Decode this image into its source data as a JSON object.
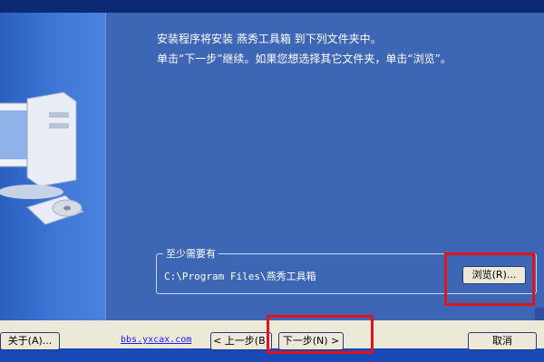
{
  "instructions": {
    "line1": "安装程序将安装 燕秀工具箱 到下列文件夹中。",
    "line2": "单击“下一步”继续。如果您想选择其它文件夹，单击“浏览”。"
  },
  "destination": {
    "group_label": "至少需要有",
    "path": "C:\\Program Files\\燕秀工具箱",
    "browse_label": "浏览(R)..."
  },
  "footer": {
    "about_label": "关于(A)...",
    "link_text": "bbs.yxcax.com",
    "back_label": "< 上一步(B)",
    "next_label": "下一步(N) >",
    "cancel_label": "取消"
  },
  "colors": {
    "background": "#3d66b5",
    "highlight": "#e1141b"
  }
}
